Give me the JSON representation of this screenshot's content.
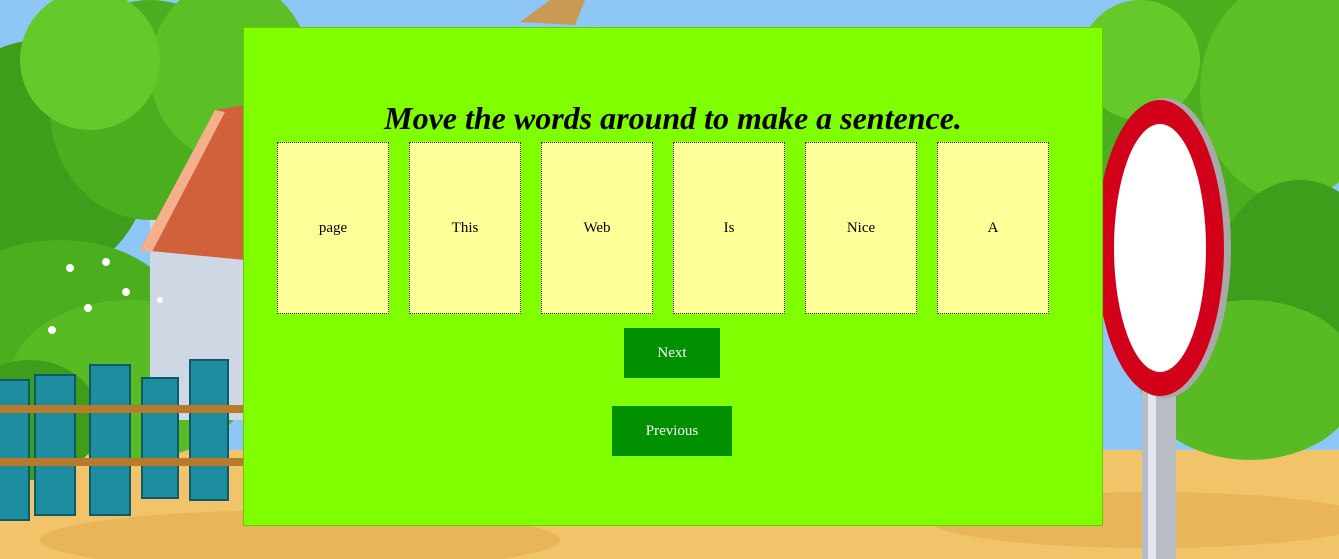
{
  "game": {
    "instruction": "Move the words around to make a sentence.",
    "word_cards": [
      "page",
      "This",
      "Web",
      "Is",
      "Nice",
      "A"
    ],
    "next_label": "Next",
    "previous_label": "Previous"
  },
  "colors": {
    "panel": "#7fff00",
    "card": "#ffff99",
    "button": "#009000",
    "sky": "#8ec6f5"
  }
}
